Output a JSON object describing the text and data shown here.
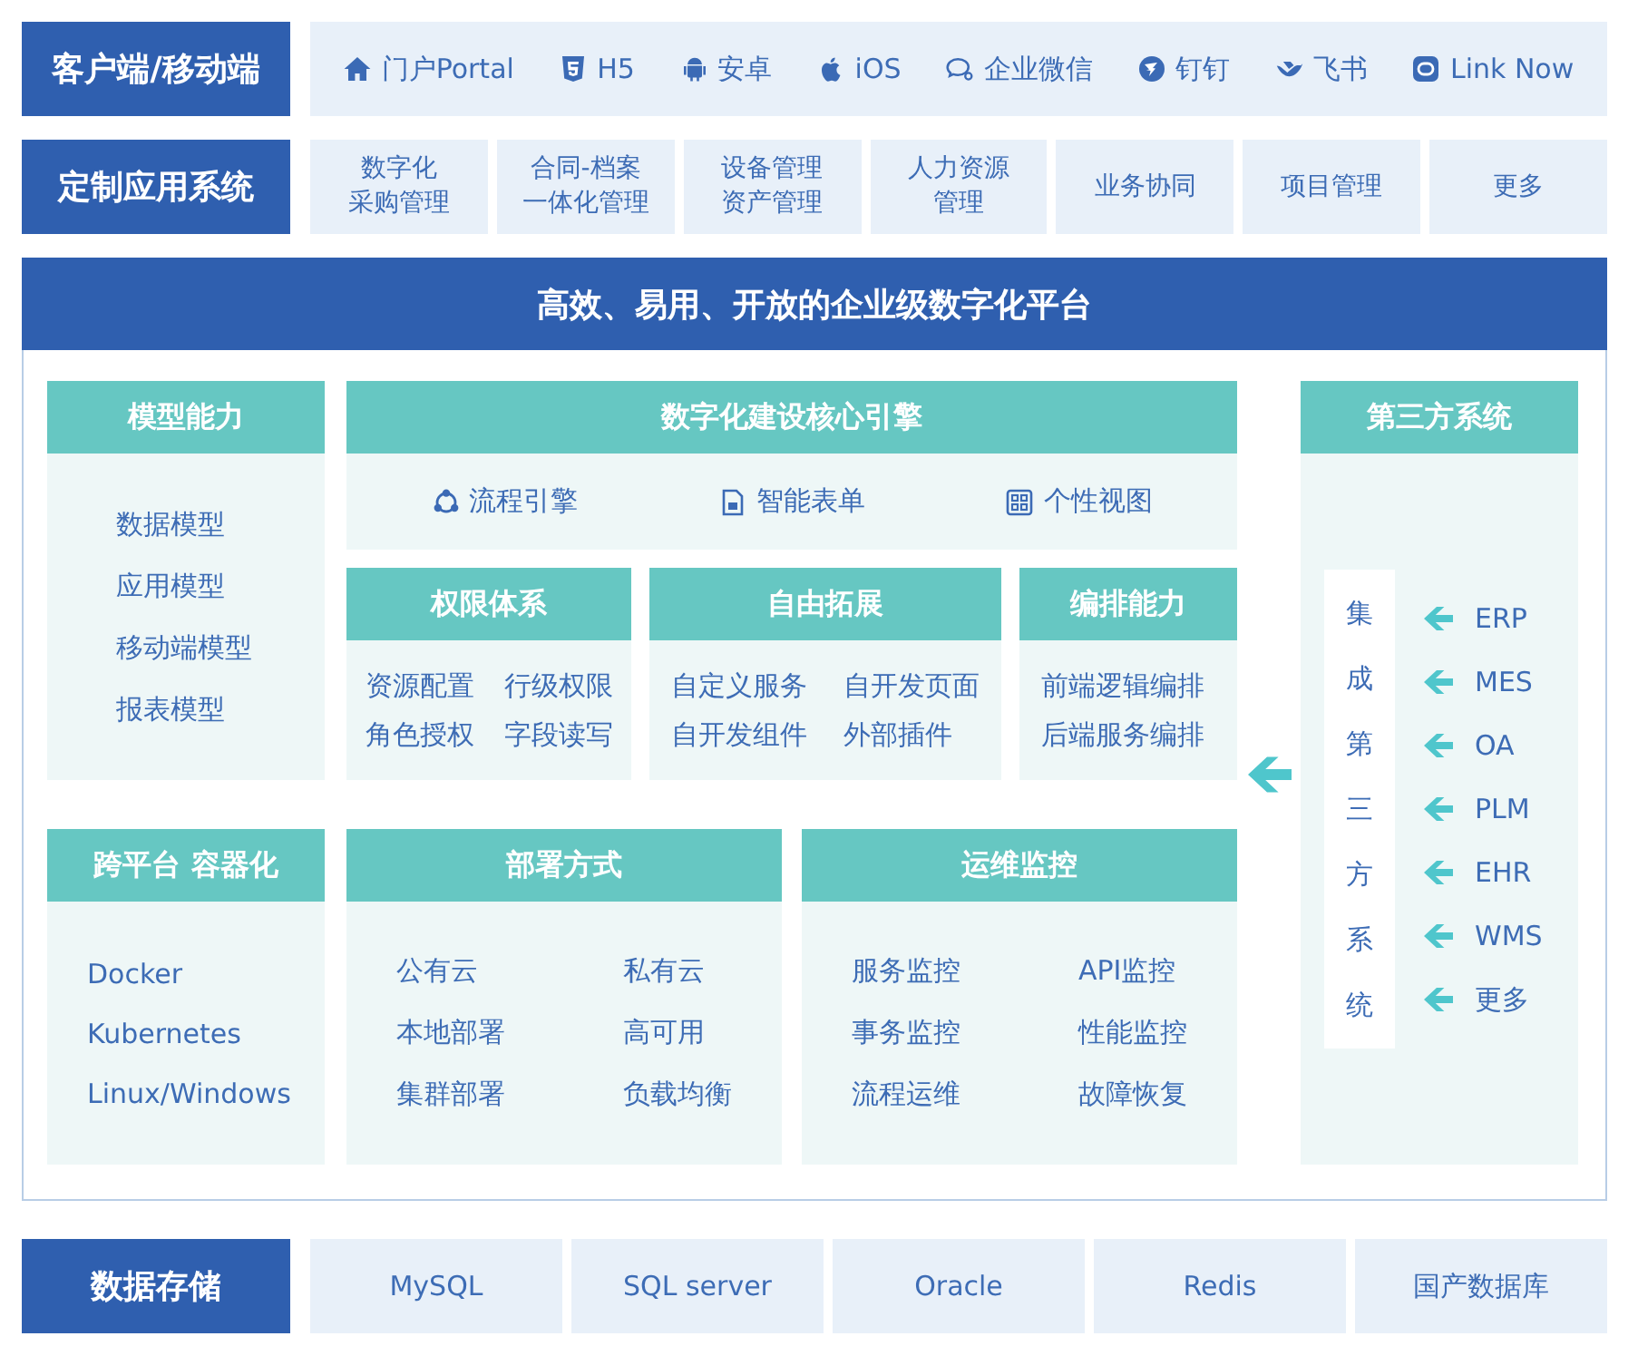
{
  "client_row": {
    "label": "客户端/移动端",
    "items": [
      "门户Portal",
      "H5",
      "安卓",
      "iOS",
      "企业微信",
      "钉钉",
      "飞书",
      "Link Now"
    ]
  },
  "custom_apps": {
    "label": "定制应用系统",
    "items": [
      {
        "lines": [
          "数字化",
          "采购管理"
        ]
      },
      {
        "lines": [
          "合同-档案",
          "一体化管理"
        ]
      },
      {
        "lines": [
          "设备管理",
          "资产管理"
        ]
      },
      {
        "lines": [
          "人力资源",
          "管理"
        ]
      },
      {
        "lines": [
          "业务协同"
        ]
      },
      {
        "lines": [
          "项目管理"
        ]
      },
      {
        "lines": [
          "更多"
        ]
      }
    ]
  },
  "platform": {
    "title": "高效、易用、开放的企业级数字化平台",
    "model": {
      "title": "模型能力",
      "items": [
        "数据模型",
        "应用模型",
        "移动端模型",
        "报表模型"
      ]
    },
    "engine": {
      "title": "数字化建设核心引擎",
      "features": [
        "流程引擎",
        "智能表单",
        "个性视图"
      ]
    },
    "permissions": {
      "title": "权限体系",
      "items": [
        "资源配置",
        "行级权限",
        "角色授权",
        "字段读写"
      ]
    },
    "extension": {
      "title": "自由拓展",
      "items": [
        "自定义服务",
        "自开发页面",
        "自开发组件",
        "外部插件"
      ]
    },
    "orchestration": {
      "title": "编排能力",
      "items": [
        "前端逻辑编排",
        "后端服务编排"
      ]
    },
    "cross_platform": {
      "title": "跨平台 容器化",
      "items": [
        "Docker",
        "Kubernetes",
        "Linux/Windows"
      ]
    },
    "deployment": {
      "title": "部署方式",
      "items": [
        "公有云",
        "私有云",
        "本地部署",
        "高可用",
        "集群部署",
        "负载均衡"
      ]
    },
    "ops": {
      "title": "运维监控",
      "items": [
        "服务监控",
        "API监控",
        "事务监控",
        "性能监控",
        "流程运维",
        "故障恢复"
      ]
    },
    "third_party": {
      "title": "第三方系统",
      "integrate_label": "集成第三方系统",
      "systems": [
        "ERP",
        "MES",
        "OA",
        "PLM",
        "EHR",
        "WMS",
        "更多"
      ]
    }
  },
  "storage": {
    "label": "数据存储",
    "items": [
      "MySQL",
      "SQL server",
      "Oracle",
      "Redis",
      "国产数据库"
    ]
  }
}
